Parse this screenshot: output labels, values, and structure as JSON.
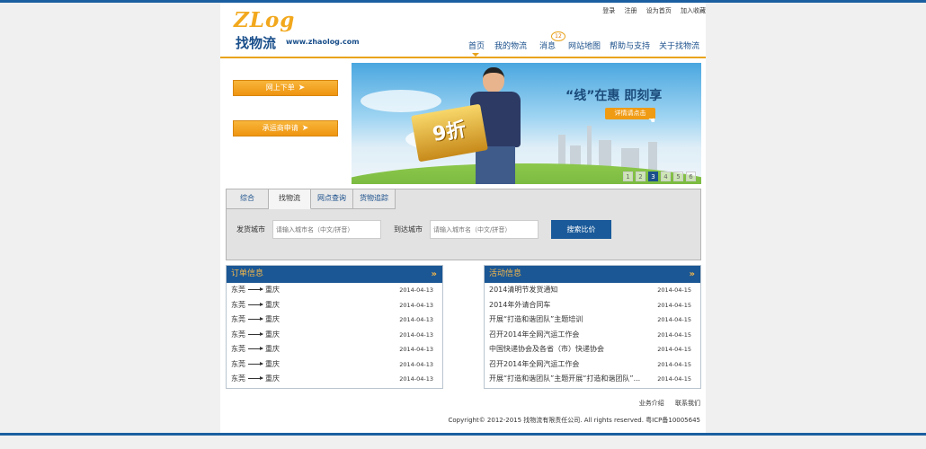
{
  "toplinks": [
    "登录",
    "注册",
    "设为首页",
    "加入收藏"
  ],
  "logo": {
    "mark": "ZLog",
    "name_cn": "找物流",
    "url": "www.zhaolog.com"
  },
  "nav": {
    "items": [
      "首页",
      "我的物流",
      "消息",
      "网站地图",
      "帮助与支持",
      "关于找物流"
    ],
    "active": "首页",
    "message_badge": "12"
  },
  "side_buttons": {
    "order_online": "网上下单",
    "carrier_apply": "承运商申请"
  },
  "banner": {
    "discount": "9折",
    "slogan": "“线”在惠  即刻享",
    "detail_button": "详情请点击",
    "pages": [
      "1",
      "2",
      "3",
      "4",
      "5",
      "6"
    ],
    "current_page": "3"
  },
  "search": {
    "tabs": [
      "综合",
      "找物流",
      "网点查询",
      "货物追踪"
    ],
    "active_tab": "找物流",
    "from_label": "发货城市",
    "to_label": "到达城市",
    "from_placeholder": "请输入城市名（中文/拼音）",
    "to_placeholder": "请输入城市名（中文/拼音）",
    "submit": "搜索比价"
  },
  "orders": {
    "title": "订单信息",
    "more": "»",
    "rows": [
      {
        "from": "东莞",
        "to": "重庆",
        "date": "2014-04-13"
      },
      {
        "from": "东莞",
        "to": "重庆",
        "date": "2014-04-13"
      },
      {
        "from": "东莞",
        "to": "重庆",
        "date": "2014-04-13"
      },
      {
        "from": "东莞",
        "to": "重庆",
        "date": "2014-04-13"
      },
      {
        "from": "东莞",
        "to": "重庆",
        "date": "2014-04-13"
      },
      {
        "from": "东莞",
        "to": "重庆",
        "date": "2014-04-13"
      },
      {
        "from": "东莞",
        "to": "重庆",
        "date": "2014-04-13"
      }
    ]
  },
  "activities": {
    "title": "活动信息",
    "more": "»",
    "rows": [
      {
        "title": "2014清明节发货通知",
        "date": "2014-04-15"
      },
      {
        "title": "2014年外请合同车",
        "date": "2014-04-15"
      },
      {
        "title": "开展“打造和谐团队”主题培训",
        "date": "2014-04-15"
      },
      {
        "title": "召开2014年全网汽运工作会",
        "date": "2014-04-15"
      },
      {
        "title": "中国快递协会及各省（市）快递协会",
        "date": "2014-04-15"
      },
      {
        "title": "召开2014年全网汽运工作会",
        "date": "2014-04-15"
      },
      {
        "title": "开展“打造和谐团队”主题开展“打造和谐团队”...",
        "date": "2014-04-15"
      }
    ]
  },
  "footer": {
    "links": [
      "业务介绍",
      "联系我们"
    ],
    "copyright": "Copyright© 2012-2015  找物流有限责任公司. All  rights  reserved.   粤ICP备10005645"
  },
  "colors": {
    "brand_blue": "#1b5794",
    "accent_orange": "#ef9410",
    "page_bg": "#f0f0f0"
  }
}
